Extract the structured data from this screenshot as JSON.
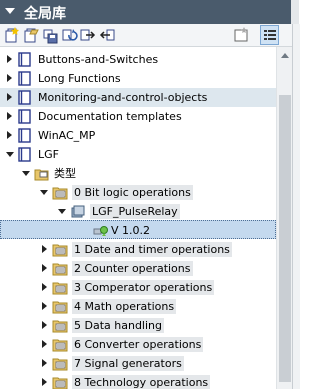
{
  "panel": {
    "title": "全局库"
  },
  "toolbar": {
    "buttons": [
      {
        "name": "new-library-icon"
      },
      {
        "name": "open-library-icon"
      },
      {
        "name": "save-library-icon"
      },
      {
        "name": "update-icon"
      },
      {
        "name": "export-icon"
      },
      {
        "name": "import-icon"
      },
      {
        "name": "library-view-icon"
      },
      {
        "name": "details-view-icon"
      }
    ]
  },
  "tree": {
    "items": [
      {
        "label": "Buttons-and-Switches"
      },
      {
        "label": "Long Functions"
      },
      {
        "label": "Monitoring-and-control-objects"
      },
      {
        "label": "Documentation templates"
      },
      {
        "label": "WinAC_MP"
      },
      {
        "label": "LGF"
      },
      {
        "label": "类型"
      },
      {
        "label": "0 Bit logic operations"
      },
      {
        "label": "LGF_PulseRelay"
      },
      {
        "label": "V 1.0.2"
      },
      {
        "label": "1 Date and timer operations"
      },
      {
        "label": "2 Counter operations"
      },
      {
        "label": "3 Comperator operations"
      },
      {
        "label": "4 Math operations"
      },
      {
        "label": "5 Data handling"
      },
      {
        "label": "6 Converter operations"
      },
      {
        "label": "7 Signal generators"
      },
      {
        "label": "8 Technology operations"
      }
    ]
  },
  "colors": {
    "titlebar": "#4a5b6c",
    "selection": "#c4d9ee",
    "hover": "#dde7ee",
    "book": "#2b3a8c",
    "folder": "#e8c66a"
  }
}
